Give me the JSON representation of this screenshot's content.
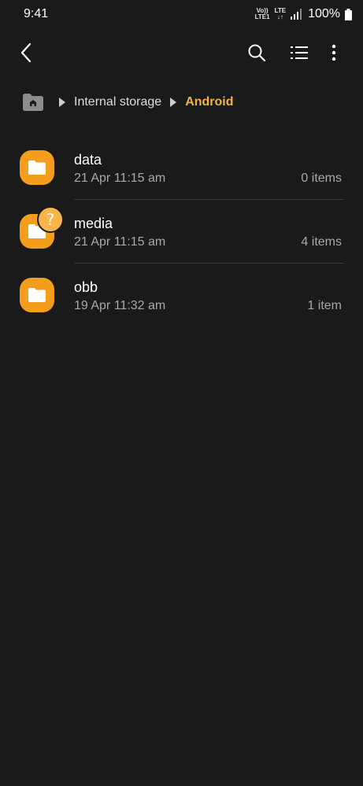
{
  "status_bar": {
    "time": "9:41",
    "volte_line1": "Vo))",
    "volte_line2": "LTE1",
    "lte_line1": "LTE",
    "lte_line2": "↓↑",
    "battery": "100%"
  },
  "toolbar": {
    "back_icon": "chevron-left",
    "search_icon": "search",
    "list_icon": "list-view",
    "more_icon": "more-vertical"
  },
  "breadcrumb": {
    "items": [
      "Internal storage",
      "Android"
    ]
  },
  "files": [
    {
      "name": "data",
      "date": "21 Apr 11:15 am",
      "count": "0 items",
      "has_badge": false
    },
    {
      "name": "media",
      "date": "21 Apr 11:15 am",
      "count": "4 items",
      "has_badge": true,
      "badge": "?"
    },
    {
      "name": "obb",
      "date": "19 Apr 11:32 am",
      "count": "1 item",
      "has_badge": false
    }
  ],
  "colors": {
    "background": "#1a1a1a",
    "accent": "#f5b340",
    "folder": "#f59e1b",
    "secondary_text": "#a9a9a9"
  }
}
